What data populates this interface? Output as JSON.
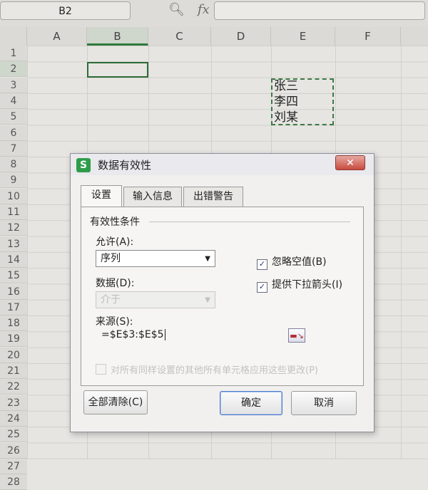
{
  "formula_bar": {
    "name_box": "B2",
    "zoom_icon": "magnifier-icon",
    "fx_label": "fx",
    "formula": ""
  },
  "sheet": {
    "columns": [
      "A",
      "B",
      "C",
      "D",
      "E",
      "F"
    ],
    "rows": [
      "1",
      "2",
      "3",
      "4",
      "5",
      "6",
      "7",
      "8",
      "9",
      "10",
      "11",
      "12",
      "13",
      "14",
      "15",
      "16",
      "17",
      "18",
      "19",
      "20",
      "21",
      "22",
      "23",
      "24",
      "25",
      "26",
      "27",
      "28"
    ],
    "active_cell": "B2",
    "cells": {
      "E3": "张三",
      "E4": "李四",
      "E5": "刘某"
    }
  },
  "dialog": {
    "title": "数据有效性",
    "logo": "S",
    "close": "✕",
    "tabs": [
      "设置",
      "输入信息",
      "出错警告"
    ],
    "selected_tab": "设置",
    "group_title": "有效性条件",
    "allow_label": "允许(A):",
    "allow_value": "序列",
    "data_label": "数据(D):",
    "data_value": "介于",
    "ignore_blank_label": "忽略空值(B)",
    "ignore_blank_checked": true,
    "dropdown_label": "提供下拉箭头(I)",
    "dropdown_checked": true,
    "source_label": "来源(S):",
    "source_value": "=$E$3:$E$5",
    "apply_all_label": "对所有同样设置的其他所有单元格应用这些更改(P)",
    "apply_all_checked": false,
    "clear_all_button": "全部清除(C)",
    "ok_button": "确定",
    "cancel_button": "取消"
  },
  "colors": {
    "selection_border": "#2f6b36",
    "close_button": "#c94a3e",
    "app_logo": "#2e9c4a"
  }
}
